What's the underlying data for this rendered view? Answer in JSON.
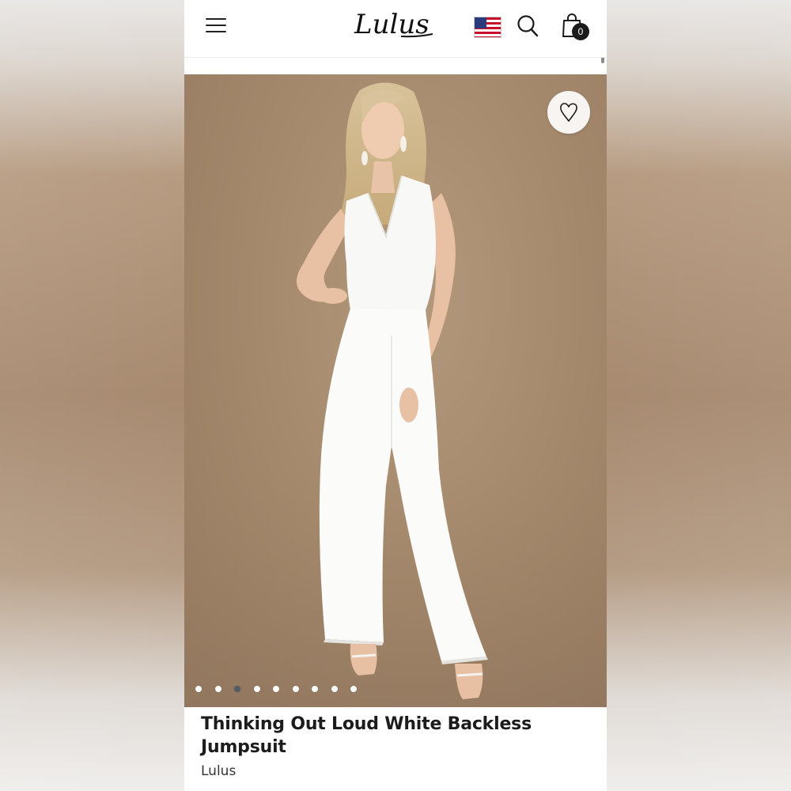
{
  "header": {
    "logo_text": "Lulus",
    "cart_count": "0",
    "icons": [
      "menu-icon",
      "us-flag-icon",
      "search-icon",
      "shopping-bag-icon"
    ]
  },
  "gallery": {
    "total_images": 9,
    "active_index": 2,
    "wishlist_icon": "heart-icon"
  },
  "product": {
    "title": "Thinking Out Loud White Backless Jumpsuit",
    "brand": "Lulus"
  },
  "colors": {
    "background_tan": "#a68a6e",
    "text": "#1c1c1c",
    "dot_active": "#555b62"
  }
}
